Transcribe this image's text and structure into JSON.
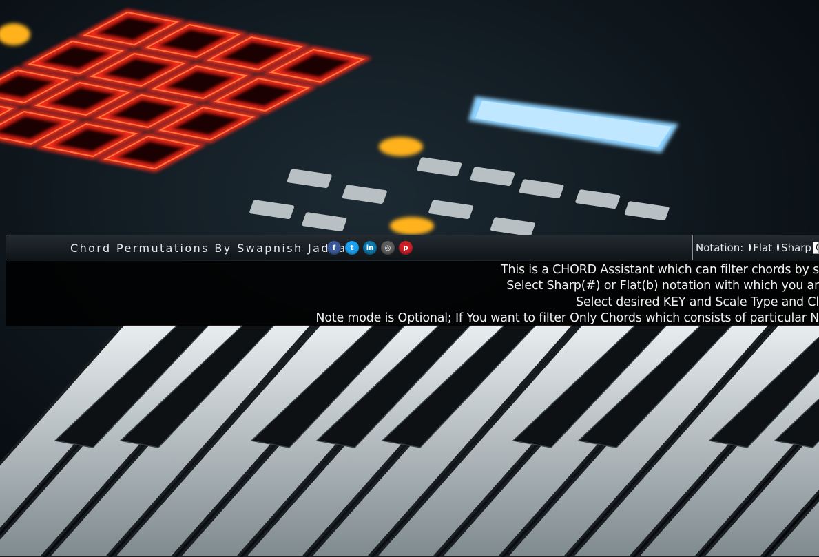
{
  "header": {
    "title": "Chord Permutations By Swapnish Jadhav",
    "social": [
      {
        "name": "facebook",
        "glyph": "f",
        "color": "#3b5998"
      },
      {
        "name": "twitter",
        "glyph": "t",
        "color": "#1da1f2"
      },
      {
        "name": "linkedin",
        "glyph": "in",
        "color": "#0e76a8"
      },
      {
        "name": "instagram",
        "glyph": "◎",
        "color": "#5d5d5d"
      },
      {
        "name": "pinterest",
        "glyph": "p",
        "color": "#cb2027"
      }
    ]
  },
  "notation": {
    "label": "Notation:",
    "options": [
      "Flat",
      "Sharp"
    ],
    "key_value": "C"
  },
  "instructions": [
    "This is a CHORD Assistant which can filter chords by s",
    "Select Sharp(#) or Flat(b) notation with which you ar",
    "Select desired KEY and Scale Type and Cl",
    "Note mode is Optional; If You want to filter Only Chords which consists of particular N"
  ],
  "colors": {
    "pad_red": "#ff2a1f",
    "lcd_blue": "#8fd3ff",
    "header_border": "#8a8f94"
  }
}
